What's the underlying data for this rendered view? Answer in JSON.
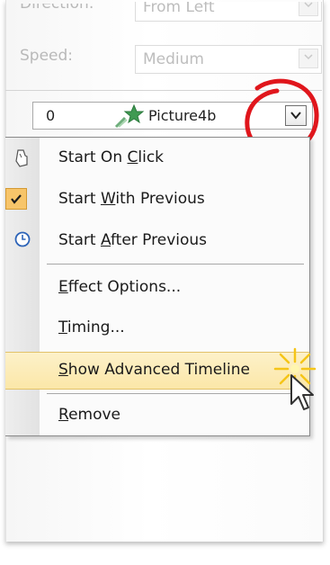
{
  "settings": {
    "direction_label": "Direction:",
    "direction_value": "From Left",
    "speed_label": "Speed:",
    "speed_value": "Medium"
  },
  "effect": {
    "order": "0",
    "name": "Picture4b",
    "icon": "star-motion-icon"
  },
  "menu": {
    "items": [
      {
        "label_pre": "Start On ",
        "label_key": "C",
        "label_post": "lick",
        "icon": "mouse-click-icon"
      },
      {
        "label_pre": "Start ",
        "label_key": "W",
        "label_post": "ith Previous",
        "icon": "checkmark-icon",
        "checked": true
      },
      {
        "label_pre": "Start ",
        "label_key": "A",
        "label_post": "fter Previous",
        "icon": "clock-icon"
      },
      {
        "label_pre": "",
        "label_key": "E",
        "label_post": "ffect Options...",
        "icon": ""
      },
      {
        "label_pre": "",
        "label_key": "T",
        "label_post": "iming...",
        "icon": ""
      },
      {
        "label_pre": "",
        "label_key": "S",
        "label_post": "how Advanced Timeline",
        "icon": "",
        "highlighted": true
      },
      {
        "label_pre": "",
        "label_key": "R",
        "label_post": "emove",
        "icon": ""
      }
    ]
  },
  "colors": {
    "highlight": "#fbe7a8",
    "annotation": "#e0161c",
    "checked_bg": "#f7c56a"
  }
}
